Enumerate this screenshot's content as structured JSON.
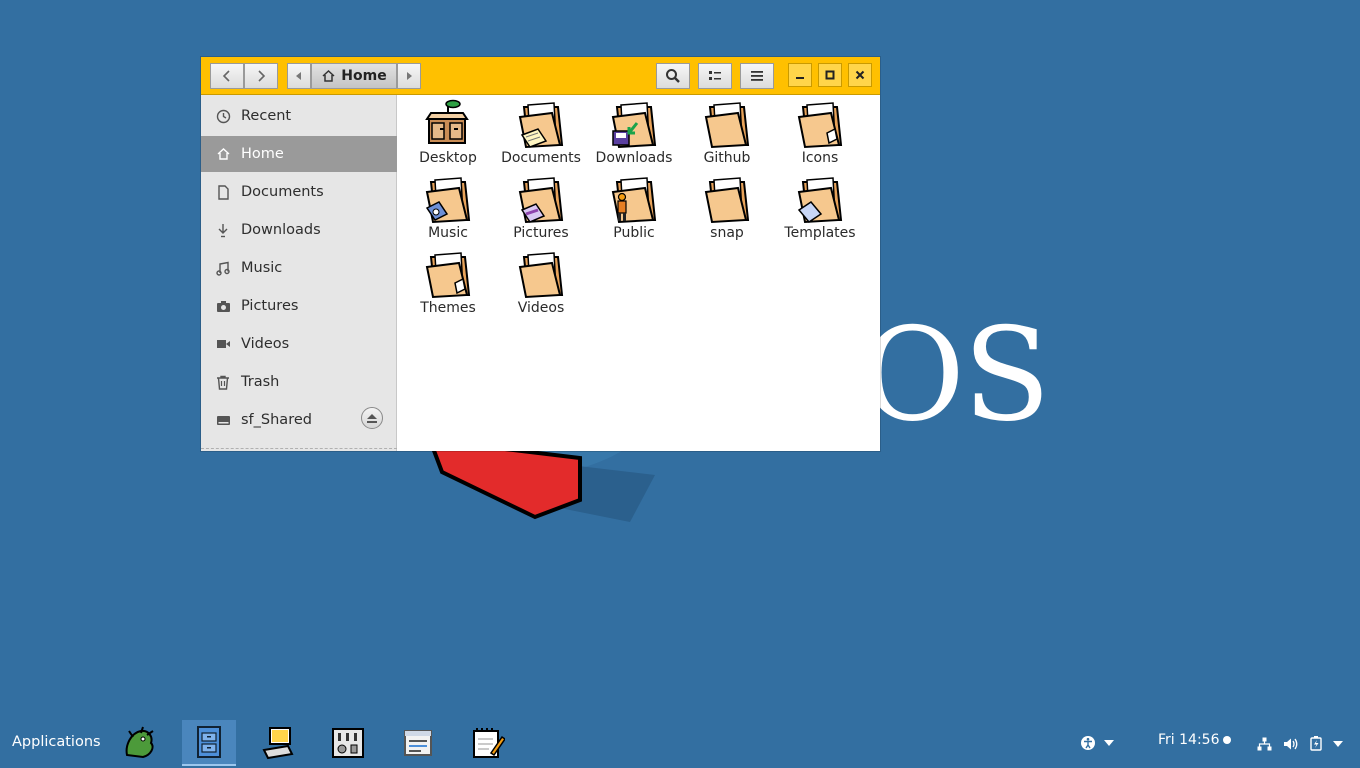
{
  "window": {
    "title": "Home",
    "pathbar": {
      "home_label": "Home"
    }
  },
  "sidebar": {
    "items": [
      {
        "label": "Recent",
        "icon": "clock-icon",
        "active": false
      },
      {
        "label": "Home",
        "icon": "home-icon",
        "active": true
      },
      {
        "label": "Documents",
        "icon": "document-icon",
        "active": false
      },
      {
        "label": "Downloads",
        "icon": "download-icon",
        "active": false
      },
      {
        "label": "Music",
        "icon": "music-icon",
        "active": false
      },
      {
        "label": "Pictures",
        "icon": "camera-icon",
        "active": false
      },
      {
        "label": "Videos",
        "icon": "video-icon",
        "active": false
      },
      {
        "label": "Trash",
        "icon": "trash-icon",
        "active": false
      },
      {
        "label": "sf_Shared",
        "icon": "drive-icon",
        "active": false
      }
    ]
  },
  "files": [
    {
      "label": "Desktop",
      "icon": "desktop-folder-icon"
    },
    {
      "label": "Documents",
      "icon": "documents-folder-icon"
    },
    {
      "label": "Downloads",
      "icon": "downloads-folder-icon"
    },
    {
      "label": "Github",
      "icon": "folder-icon"
    },
    {
      "label": "Icons",
      "icon": "icons-folder-icon"
    },
    {
      "label": "Music",
      "icon": "music-folder-icon"
    },
    {
      "label": "Pictures",
      "icon": "pictures-folder-icon"
    },
    {
      "label": "Public",
      "icon": "public-folder-icon"
    },
    {
      "label": "snap",
      "icon": "folder-icon"
    },
    {
      "label": "Templates",
      "icon": "templates-folder-icon"
    },
    {
      "label": "Themes",
      "icon": "themes-folder-icon"
    },
    {
      "label": "Videos",
      "icon": "folder-icon"
    }
  ],
  "taskbar": {
    "applications_label": "Applications",
    "clock": "Fri 14:56",
    "launchers": [
      {
        "icon": "dragon-icon",
        "active": false
      },
      {
        "icon": "file-cabinet-icon",
        "active": true
      },
      {
        "icon": "computer-icon",
        "active": false
      },
      {
        "icon": "mixer-icon",
        "active": false
      },
      {
        "icon": "window-icon",
        "active": false
      },
      {
        "icon": "notepad-icon",
        "active": false
      }
    ]
  },
  "wallpaper": {
    "text": "OS"
  },
  "colors": {
    "desktop_bg": "#336fa1",
    "headerbar": "#ffc000",
    "sidebar_active": "#9a9a9a"
  }
}
